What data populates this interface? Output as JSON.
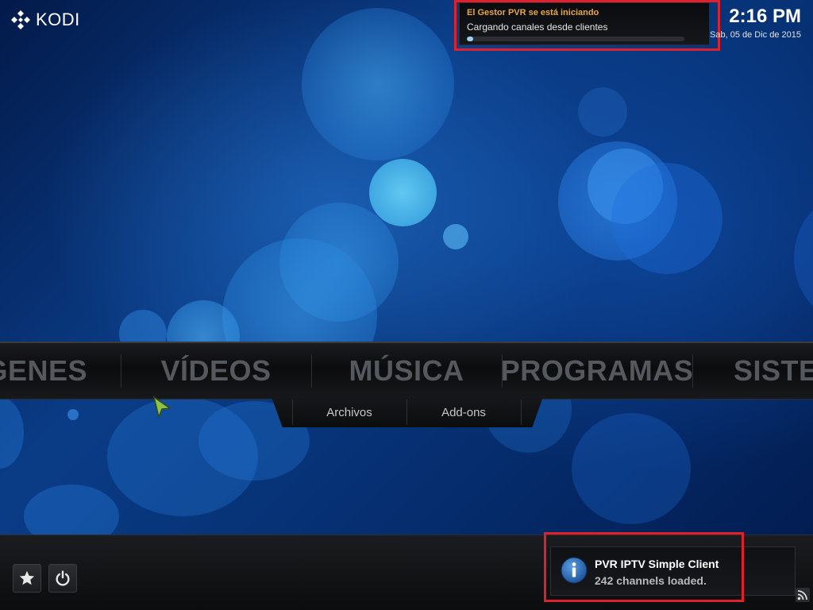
{
  "app": {
    "name": "KODI",
    "logo_icon": "kodi-logo-icon"
  },
  "pvr_dialog": {
    "title": "El Gestor PVR se está iniciando",
    "message": "Cargando canales desde clientes",
    "progress_percent": 2,
    "title_color": "#e8a83a"
  },
  "clock": {
    "time": "2:16 PM",
    "date": "Sab, 05 de Dic de 2015"
  },
  "main_menu": {
    "items": [
      {
        "label": "ÁGENES"
      },
      {
        "label": "VÍDEOS"
      },
      {
        "label": "MÚSICA"
      },
      {
        "label": "PROGRAMAS"
      },
      {
        "label": "SISTE"
      }
    ]
  },
  "submenu": {
    "items": [
      {
        "label": "Archivos"
      },
      {
        "label": "Add-ons"
      }
    ]
  },
  "bottom_bar": {
    "favourites_icon": "star-icon",
    "power_icon": "power-icon"
  },
  "notification": {
    "icon": "info-icon",
    "title": "PVR IPTV Simple Client",
    "message": "242 channels loaded."
  },
  "status_icons": {
    "rss": "rss-icon"
  },
  "colors": {
    "highlight": "#e0202a",
    "menu_text": "#55585d",
    "accent": "#9fd0f0"
  }
}
